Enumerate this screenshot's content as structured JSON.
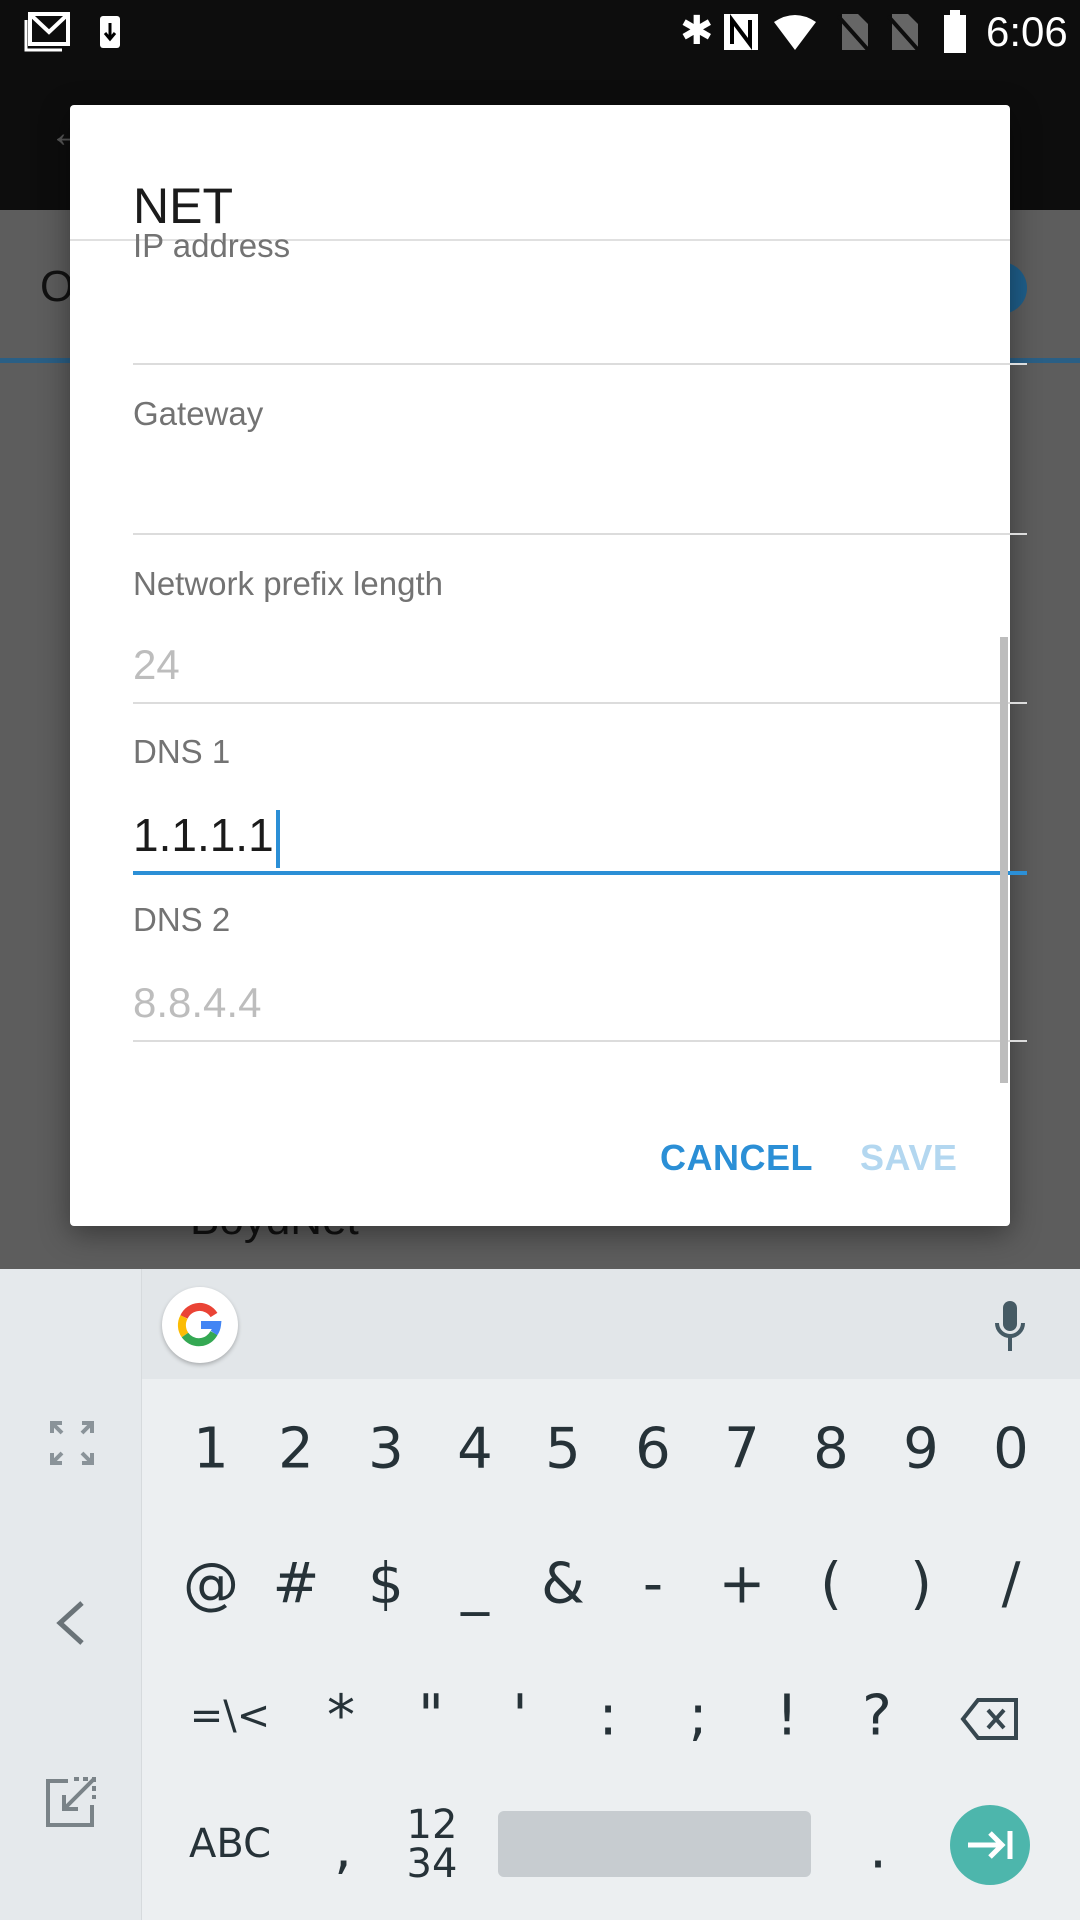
{
  "status_bar": {
    "time": "6:06",
    "icons": [
      "gmail-icon",
      "download-icon",
      "bluetooth-icon",
      "nfc-icon",
      "wifi-icon",
      "no-sim-icon",
      "no-sim-icon",
      "battery-icon"
    ]
  },
  "background": {
    "partial_text": "O",
    "last_network": "BoydNet"
  },
  "dialog": {
    "title": "NET",
    "fields": [
      {
        "label": "IP address",
        "value": ""
      },
      {
        "label": "Gateway",
        "value": ""
      },
      {
        "label": "Network prefix length",
        "placeholder": "24"
      },
      {
        "label": "DNS 1",
        "value": "1.1.1.1"
      },
      {
        "label": "DNS 2",
        "placeholder": "8.8.4.4"
      }
    ],
    "cancel": "CANCEL",
    "save": "SAVE"
  },
  "keyboard": {
    "row1": [
      "1",
      "2",
      "3",
      "4",
      "5",
      "6",
      "7",
      "8",
      "9",
      "0"
    ],
    "row2": [
      "@",
      "#",
      "$",
      "_",
      "&",
      "-",
      "+",
      "(",
      ")",
      "/"
    ],
    "row3": [
      "=\\<",
      "*",
      "\"",
      "'",
      ":",
      ";",
      "!",
      "?"
    ],
    "abc": "ABC",
    "comma": ",",
    "numpad_top": "12",
    "numpad_bottom": "34",
    "period": "."
  },
  "colors": {
    "accent": "#2b8fd6",
    "save_disabled": "#b3d7f0",
    "enter": "#4db6ac"
  }
}
